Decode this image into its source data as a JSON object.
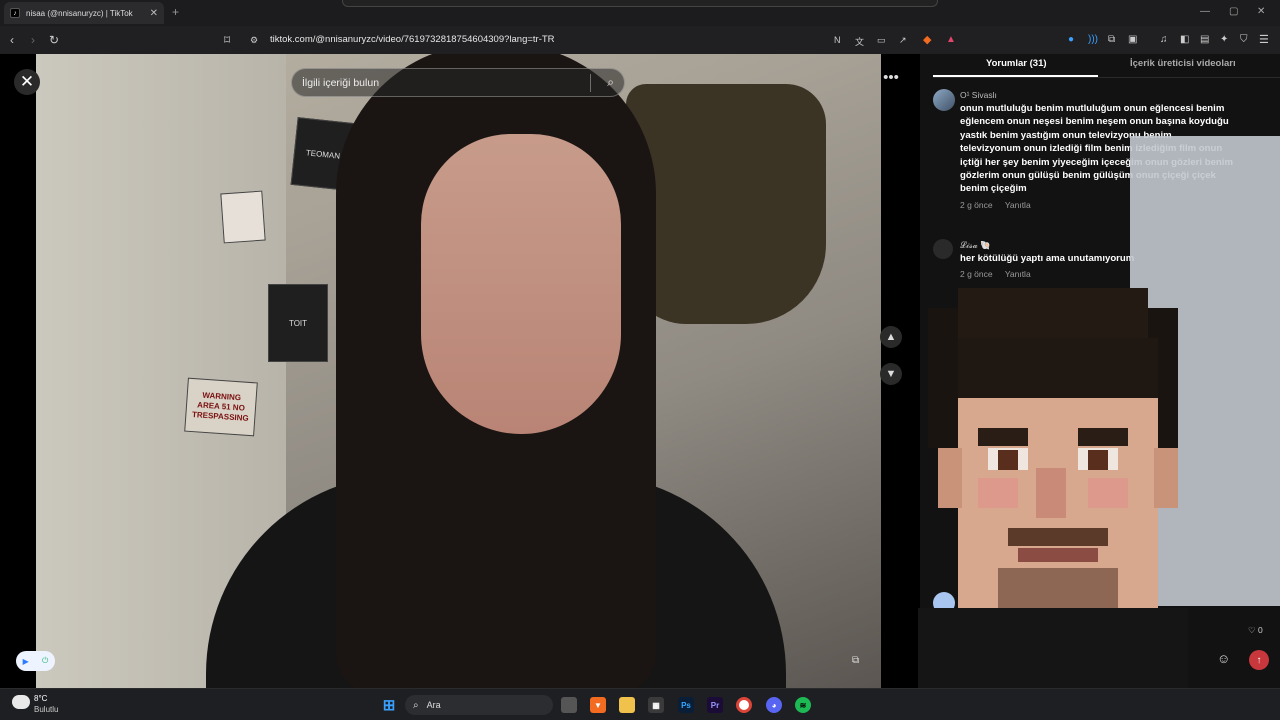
{
  "browser": {
    "tab_title": "nisaa (@nnisanuryzc) | TikTok",
    "url": "tiktok.com/@nnisanuryzc/video/7619732818754604309?lang=tr-TR"
  },
  "video": {
    "search_placeholder": "İlgili içeriği bulun",
    "posters": [
      "TEOMAN",
      "WARNING AREA 51 NO TRESPASSING",
      "TOIT"
    ]
  },
  "panel": {
    "tabs": [
      "Yorumlar (31)",
      "İçerik üreticisi videoları"
    ],
    "comments": [
      {
        "user": "O¹ Sivaslı",
        "text": "onun mutluluğu benim mutluluğum onun eğlencesi benim eğlencem onun neşesi benim neşem onun başına koyduğu yastık benim yastığım onun televizyonu benim televizyonum onun izlediği film benim izlediğim film onun içtiği her şey benim yiyeceğim içeceğim onun gözleri benim gözlerim onun gülüşü benim gülüşüm onun çiçeği çiçek benim çiçeğim",
        "time": "2 g önce",
        "reply": "Yanıtla"
      },
      {
        "user": "𝓛𝓲𝓼𝓪 🐚",
        "text": "her kötülüğü yaptı ama unutamıyorum",
        "time": "2 g önce",
        "reply": "Yanıtla"
      }
    ],
    "like_count": "0"
  },
  "taskbar": {
    "temperature": "8°C",
    "weather": "Bulutlu",
    "search_label": "Ara",
    "apps": [
      "Ps",
      "Pr"
    ]
  }
}
